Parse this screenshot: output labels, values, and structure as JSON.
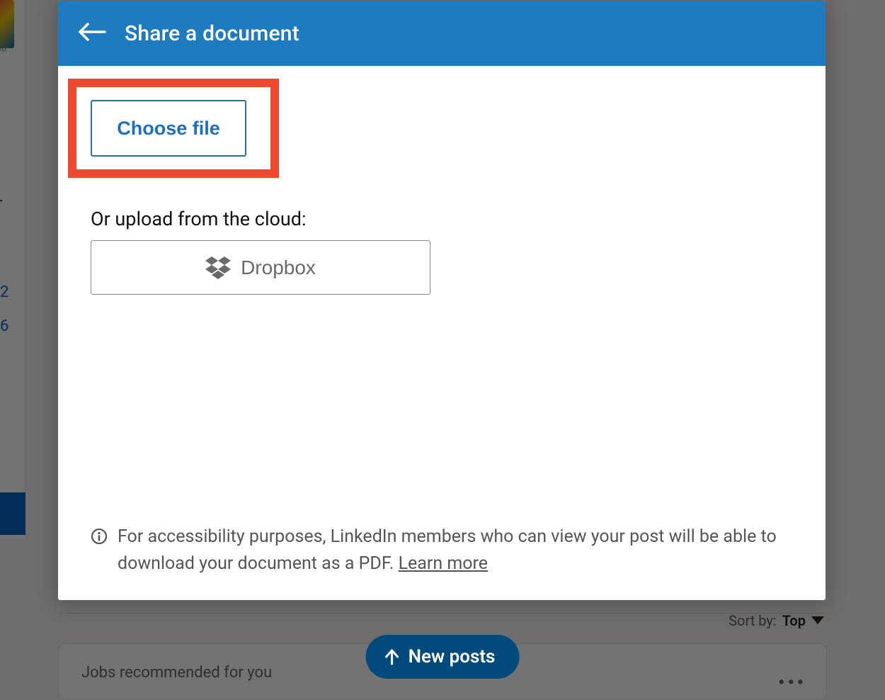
{
  "modal": {
    "title": "Share a document",
    "choose_file_label": "Choose file",
    "cloud_label": "Or upload from the cloud:",
    "dropbox_label": "Dropbox",
    "info_text": "For accessibility purposes, LinkedIn members who can view your post will be able to download your document as a PDF. ",
    "learn_more": "Learn more"
  },
  "feed": {
    "sort_label": "Sort by:",
    "sort_value": "Top",
    "card_title": "Jobs recommended for you",
    "new_posts_label": "New posts"
  },
  "bg": {
    "om": "OM",
    "r": "r",
    "n1": "2",
    "n2": "6"
  }
}
